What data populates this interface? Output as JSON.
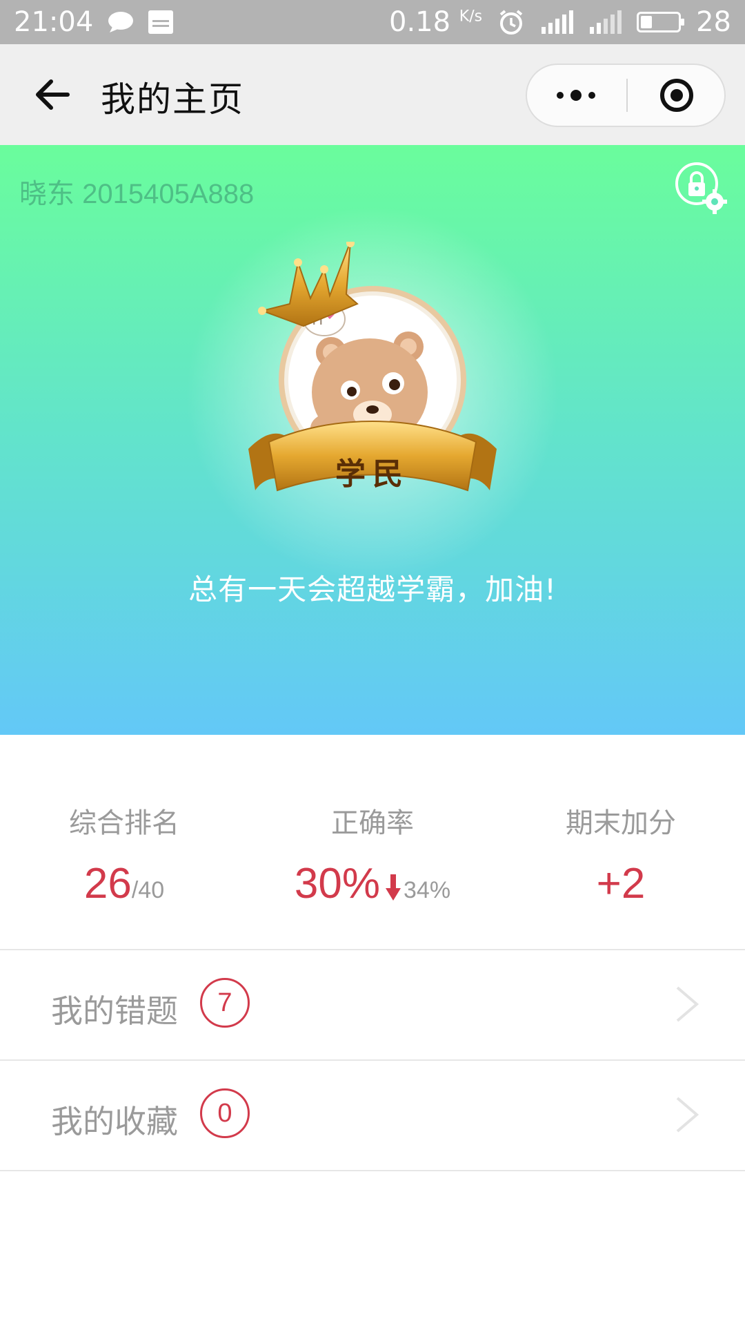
{
  "status_bar": {
    "time": "21:04",
    "speed_value": "0.18",
    "speed_unit": "K/s",
    "battery_level": "28"
  },
  "nav": {
    "title": "我的主页"
  },
  "hero": {
    "user_id": "晓东 2015405A888",
    "badge_label": "学民",
    "motto": "总有一天会超越学霸，加油!"
  },
  "stats": {
    "ranking": {
      "label": "综合排名",
      "value": "26",
      "total": "/40"
    },
    "accuracy": {
      "label": "正确率",
      "value": "30%",
      "delta": "34%"
    },
    "bonus": {
      "label": "期末加分",
      "value": "+2"
    }
  },
  "list": {
    "wrong": {
      "label": "我的错题",
      "count": "7"
    },
    "favorites": {
      "label": "我的收藏",
      "count": "0"
    }
  },
  "colors": {
    "accent_red": "#d23a4b",
    "gradient_top": "#6afd9c",
    "gradient_bottom": "#63c8f7"
  }
}
